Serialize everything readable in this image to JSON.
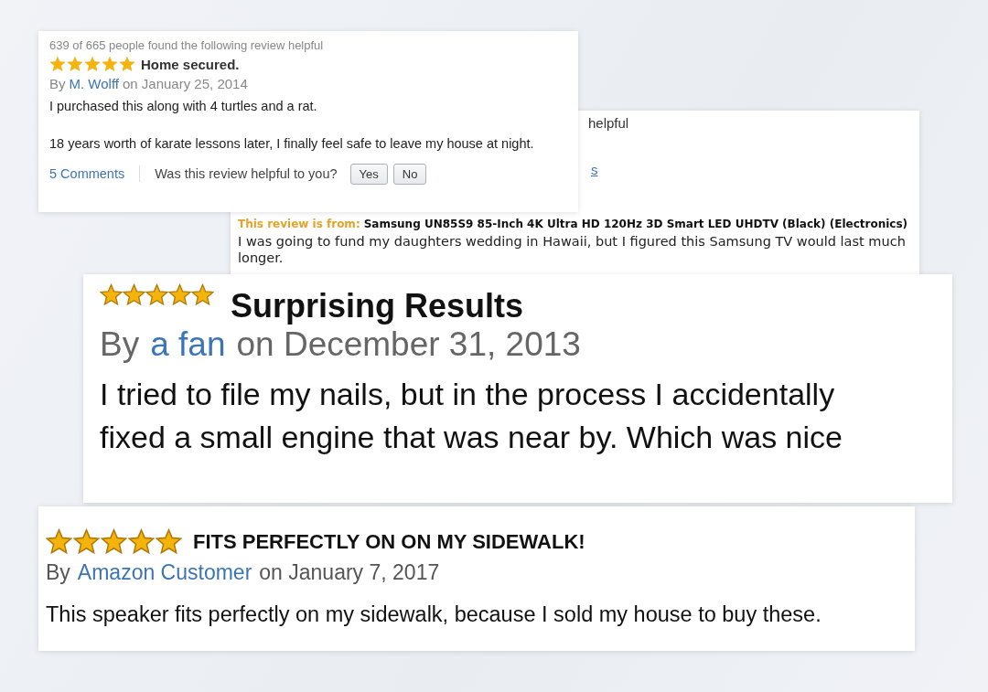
{
  "reviews": [
    {
      "kind": "classic",
      "helpful_count": "639 of 665 people found the following review helpful",
      "stars": 5,
      "title": "Home secured.",
      "by": "By",
      "author": "M. Wolff",
      "date": "on January 25, 2014",
      "body": [
        "I purchased this along with 4 turtles and a rat.",
        "18 years worth of karate lessons later, I finally feel safe to leave my house at night."
      ],
      "comments": "5 Comments",
      "helpful_question": "Was this review helpful to you?",
      "buttons": [
        "Yes",
        "No"
      ]
    },
    {
      "kind": "partial",
      "helpful_fragment": "helpful",
      "link_fragment": "s",
      "source_label": "This review is from:",
      "product": "Samsung UN85S9 85-Inch 4K Ultra HD 120Hz 3D Smart LED UHDTV (Black) (Electronics)",
      "body": [
        "I was going to fund my daughters wedding in Hawaii, but I figured this Samsung TV would last much longer."
      ]
    },
    {
      "kind": "large",
      "stars": 5,
      "title": "Surprising Results",
      "by": "By",
      "author": "a fan",
      "date": "on December 31, 2013",
      "body": [
        "I tried to file my nails, but in the process I accidentally fixed a small engine that was near by. Which was nice"
      ]
    },
    {
      "kind": "medium",
      "stars": 5,
      "title": "FITS PERFECTLY ON ON MY SIDEWALK!",
      "by": "By",
      "author": "Amazon Customer",
      "date": "on January 7, 2017",
      "body": [
        "This speaker fits perfectly on my sidewalk, because I sold my house to buy these."
      ]
    }
  ]
}
